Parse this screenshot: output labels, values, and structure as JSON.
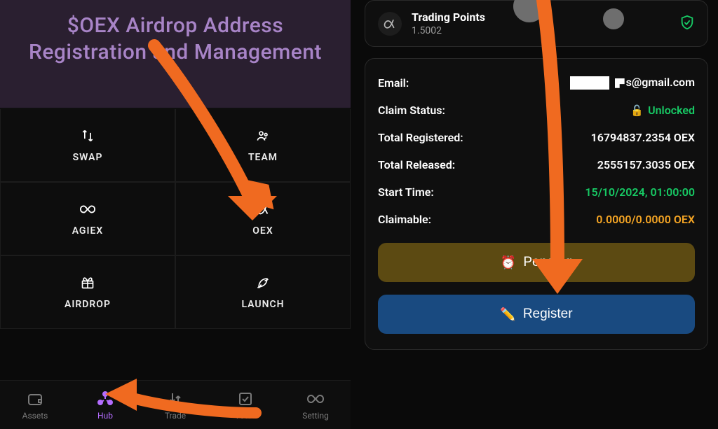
{
  "hero": {
    "title_line1": "$OEX Airdrop Address",
    "title_line2": "Registration and Management"
  },
  "hub": [
    {
      "label": "SWAP",
      "icon": "swap-icon"
    },
    {
      "label": "TEAM",
      "icon": "team-icon"
    },
    {
      "label": "AGIEX",
      "icon": "infinity-icon"
    },
    {
      "label": "OEX",
      "icon": "alpha-icon"
    },
    {
      "label": "AIRDROP",
      "icon": "gift-icon"
    },
    {
      "label": "LAUNCH",
      "icon": "rocket-icon"
    }
  ],
  "nav": [
    {
      "label": "Assets",
      "icon": "wallet-icon"
    },
    {
      "label": "Hub",
      "icon": "hub-icon",
      "active": true
    },
    {
      "label": "Trade",
      "icon": "trade-icon"
    },
    {
      "label": "Votes",
      "icon": "vote-icon"
    },
    {
      "label": "Setting",
      "icon": "setting-icon"
    }
  ],
  "tp": {
    "title": "Trading Points",
    "value": "1.5002"
  },
  "info": {
    "email_label": "Email:",
    "email_value_suffix": "s@gmail.com",
    "claim_status_label": "Claim Status:",
    "claim_status_value": "Unlocked",
    "total_registered_label": "Total Registered:",
    "total_registered_value": "16794837.2354 OEX",
    "total_released_label": "Total Released:",
    "total_released_value": "2555157.3035 OEX",
    "start_time_label": "Start Time:",
    "start_time_value": "15/10/2024, 01:00:00",
    "claimable_label": "Claimable:",
    "claimable_value": "0.0000/0.0000 OEX"
  },
  "buttons": {
    "pending": "Pending",
    "register": "Register"
  },
  "colors": {
    "accent_purple": "#b46dff",
    "accent_green": "#17c964",
    "accent_yellow": "#f5a524",
    "arrow_orange": "#f06a20"
  }
}
